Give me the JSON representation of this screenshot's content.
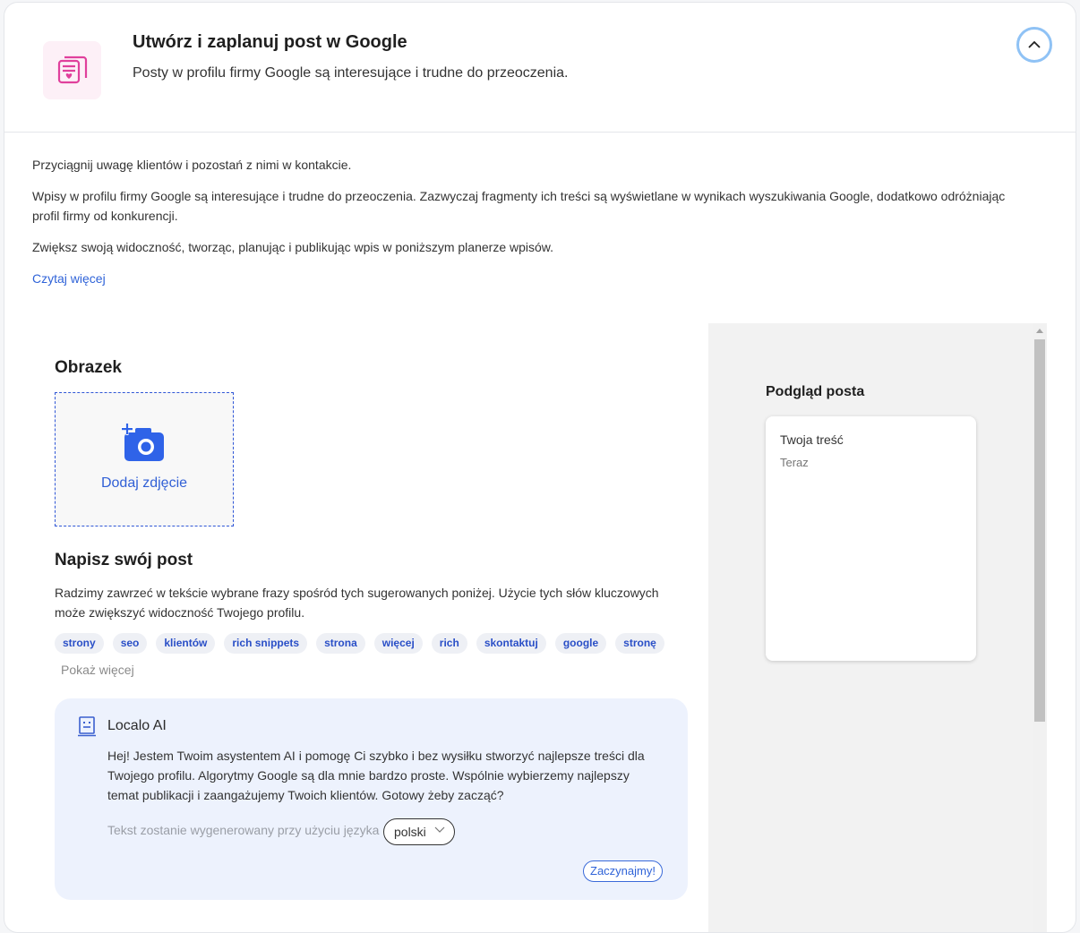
{
  "header": {
    "title": "Utwórz i zaplanuj post w Google",
    "subtitle": "Posty w profilu firmy Google są interesujące i trudne do przeoczenia.",
    "icon": "posts-icon",
    "accent_color": "#e0409c"
  },
  "intro": {
    "p1": "Przyciągnij uwagę klientów i pozostań z nimi w kontakcie.",
    "p2": "Wpisy w profilu firmy Google są interesujące i trudne do przeoczenia. Zazwyczaj fragmenty ich treści są wyświetlane w wynikach wyszukiwania Google, dodatkowo odróżniając profil firmy od konkurencji.",
    "p3": "Zwiększ swoją widoczność, tworząc, planując i publikując wpis w poniższym planerze wpisów.",
    "read_more": "Czytaj więcej"
  },
  "image_section": {
    "title": "Obrazek",
    "upload_label": "Dodaj zdjęcie"
  },
  "write_section": {
    "title": "Napisz swój post",
    "description": "Radzimy zawrzeć w tekście wybrane frazy spośród tych sugerowanych poniżej. Użycie tych słów kluczowych może zwiększyć widoczność Twojego profilu.",
    "tags": [
      "strony",
      "seo",
      "klientów",
      "rich snippets",
      "strona",
      "więcej",
      "rich",
      "skontaktuj",
      "google",
      "stronę"
    ],
    "show_more": "Pokaż więcej"
  },
  "ai": {
    "title": "Localo AI",
    "message": "Hej! Jestem Twoim asystentem AI i pomogę Ci szybko i bez wysiłku stworzyć najlepsze treści dla Twojego profilu. Algorytmy Google są dla mnie bardzo proste. Wspólnie wybierzemy najlepszy temat publikacji i zaangażujemy Twoich klientów. Gotowy żeby zacząć?",
    "language_label": "Tekst zostanie wygenerowany przy użyciu języka",
    "language_value": "polski",
    "start_button": "Zaczynajmy!"
  },
  "preview": {
    "title": "Podgląd posta",
    "content": "Twoja treść",
    "time": "Teraz"
  }
}
